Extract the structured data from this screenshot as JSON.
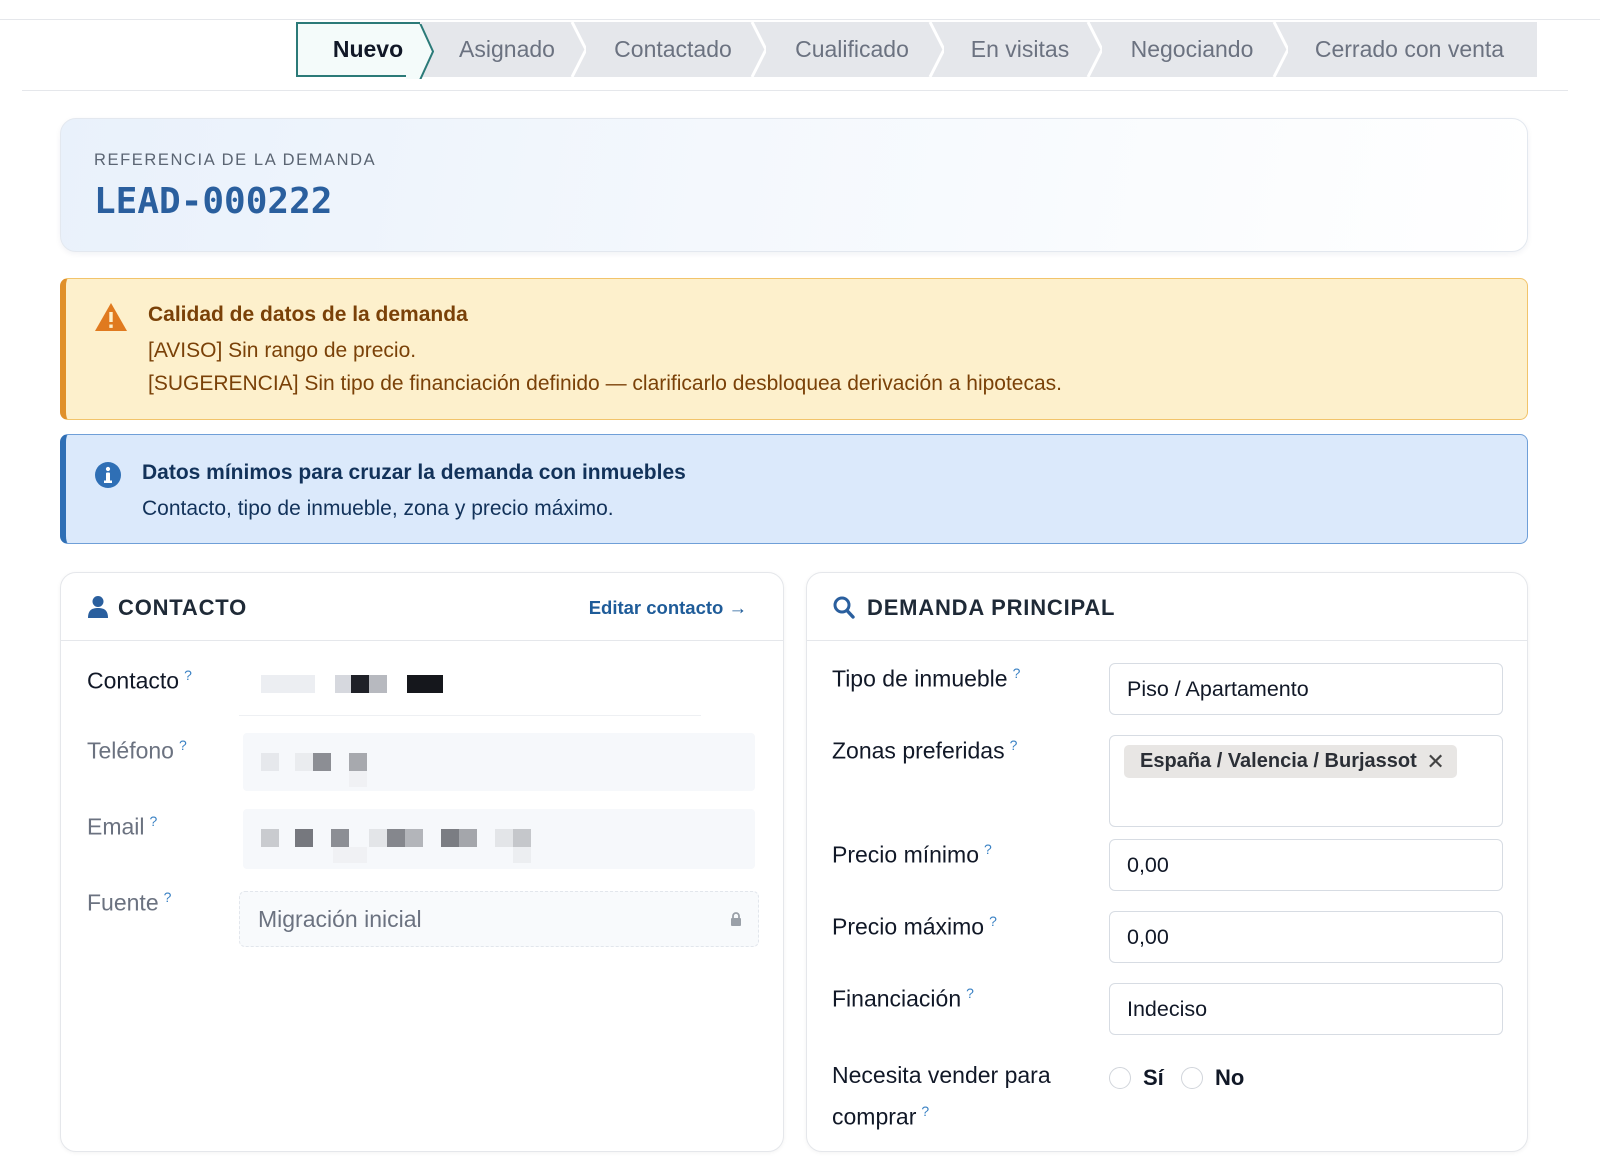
{
  "status_bar": {
    "stages": [
      "Nuevo",
      "Asignado",
      "Contactado",
      "Cualificado",
      "En visitas",
      "Negociando",
      "Cerrado con venta"
    ],
    "active": "Nuevo"
  },
  "reference": {
    "label": "REFERENCIA DE LA DEMANDA",
    "value": "LEAD-000222"
  },
  "warning": {
    "title": "Calidad de datos de la demanda",
    "lines": [
      "[AVISO] Sin rango de precio.",
      "[SUGERENCIA] Sin tipo de financiación definido — clarificarlo desbloquea derivación a hipotecas."
    ]
  },
  "info": {
    "title": "Datos mínimos para cruzar la demanda con inmuebles",
    "text": "Contacto, tipo de inmueble, zona y precio máximo."
  },
  "contact_panel": {
    "title": "CONTACTO",
    "edit_link": "Editar contacto →",
    "help_mark": "?",
    "fields": {
      "contacto": "Contacto",
      "telefono": "Teléfono",
      "email": "Email",
      "fuente": "Fuente"
    },
    "fuente_value": "Migración inicial"
  },
  "demand_panel": {
    "title": "DEMANDA PRINCIPAL",
    "fields": {
      "tipo": "Tipo de inmueble",
      "zonas": "Zonas preferidas",
      "precio_min": "Precio mínimo",
      "precio_max": "Precio máximo",
      "financiacion": "Financiación",
      "necesita_1": "Necesita vender para",
      "necesita_2": "comprar"
    },
    "values": {
      "tipo": "Piso / Apartamento",
      "zona_tag": "España / Valencia / Burjassot",
      "tag_remove": "✕",
      "precio_min": "0,00",
      "precio_max": "0,00",
      "financiacion": "Indeciso"
    },
    "radio": {
      "yes": "Sí",
      "no": "No"
    }
  },
  "colors": {
    "accent": "#2b7a78",
    "ref_value": "#2a5f9e",
    "warning_text": "#7a4108",
    "info_text": "#12325a",
    "link": "#1f5c99"
  }
}
